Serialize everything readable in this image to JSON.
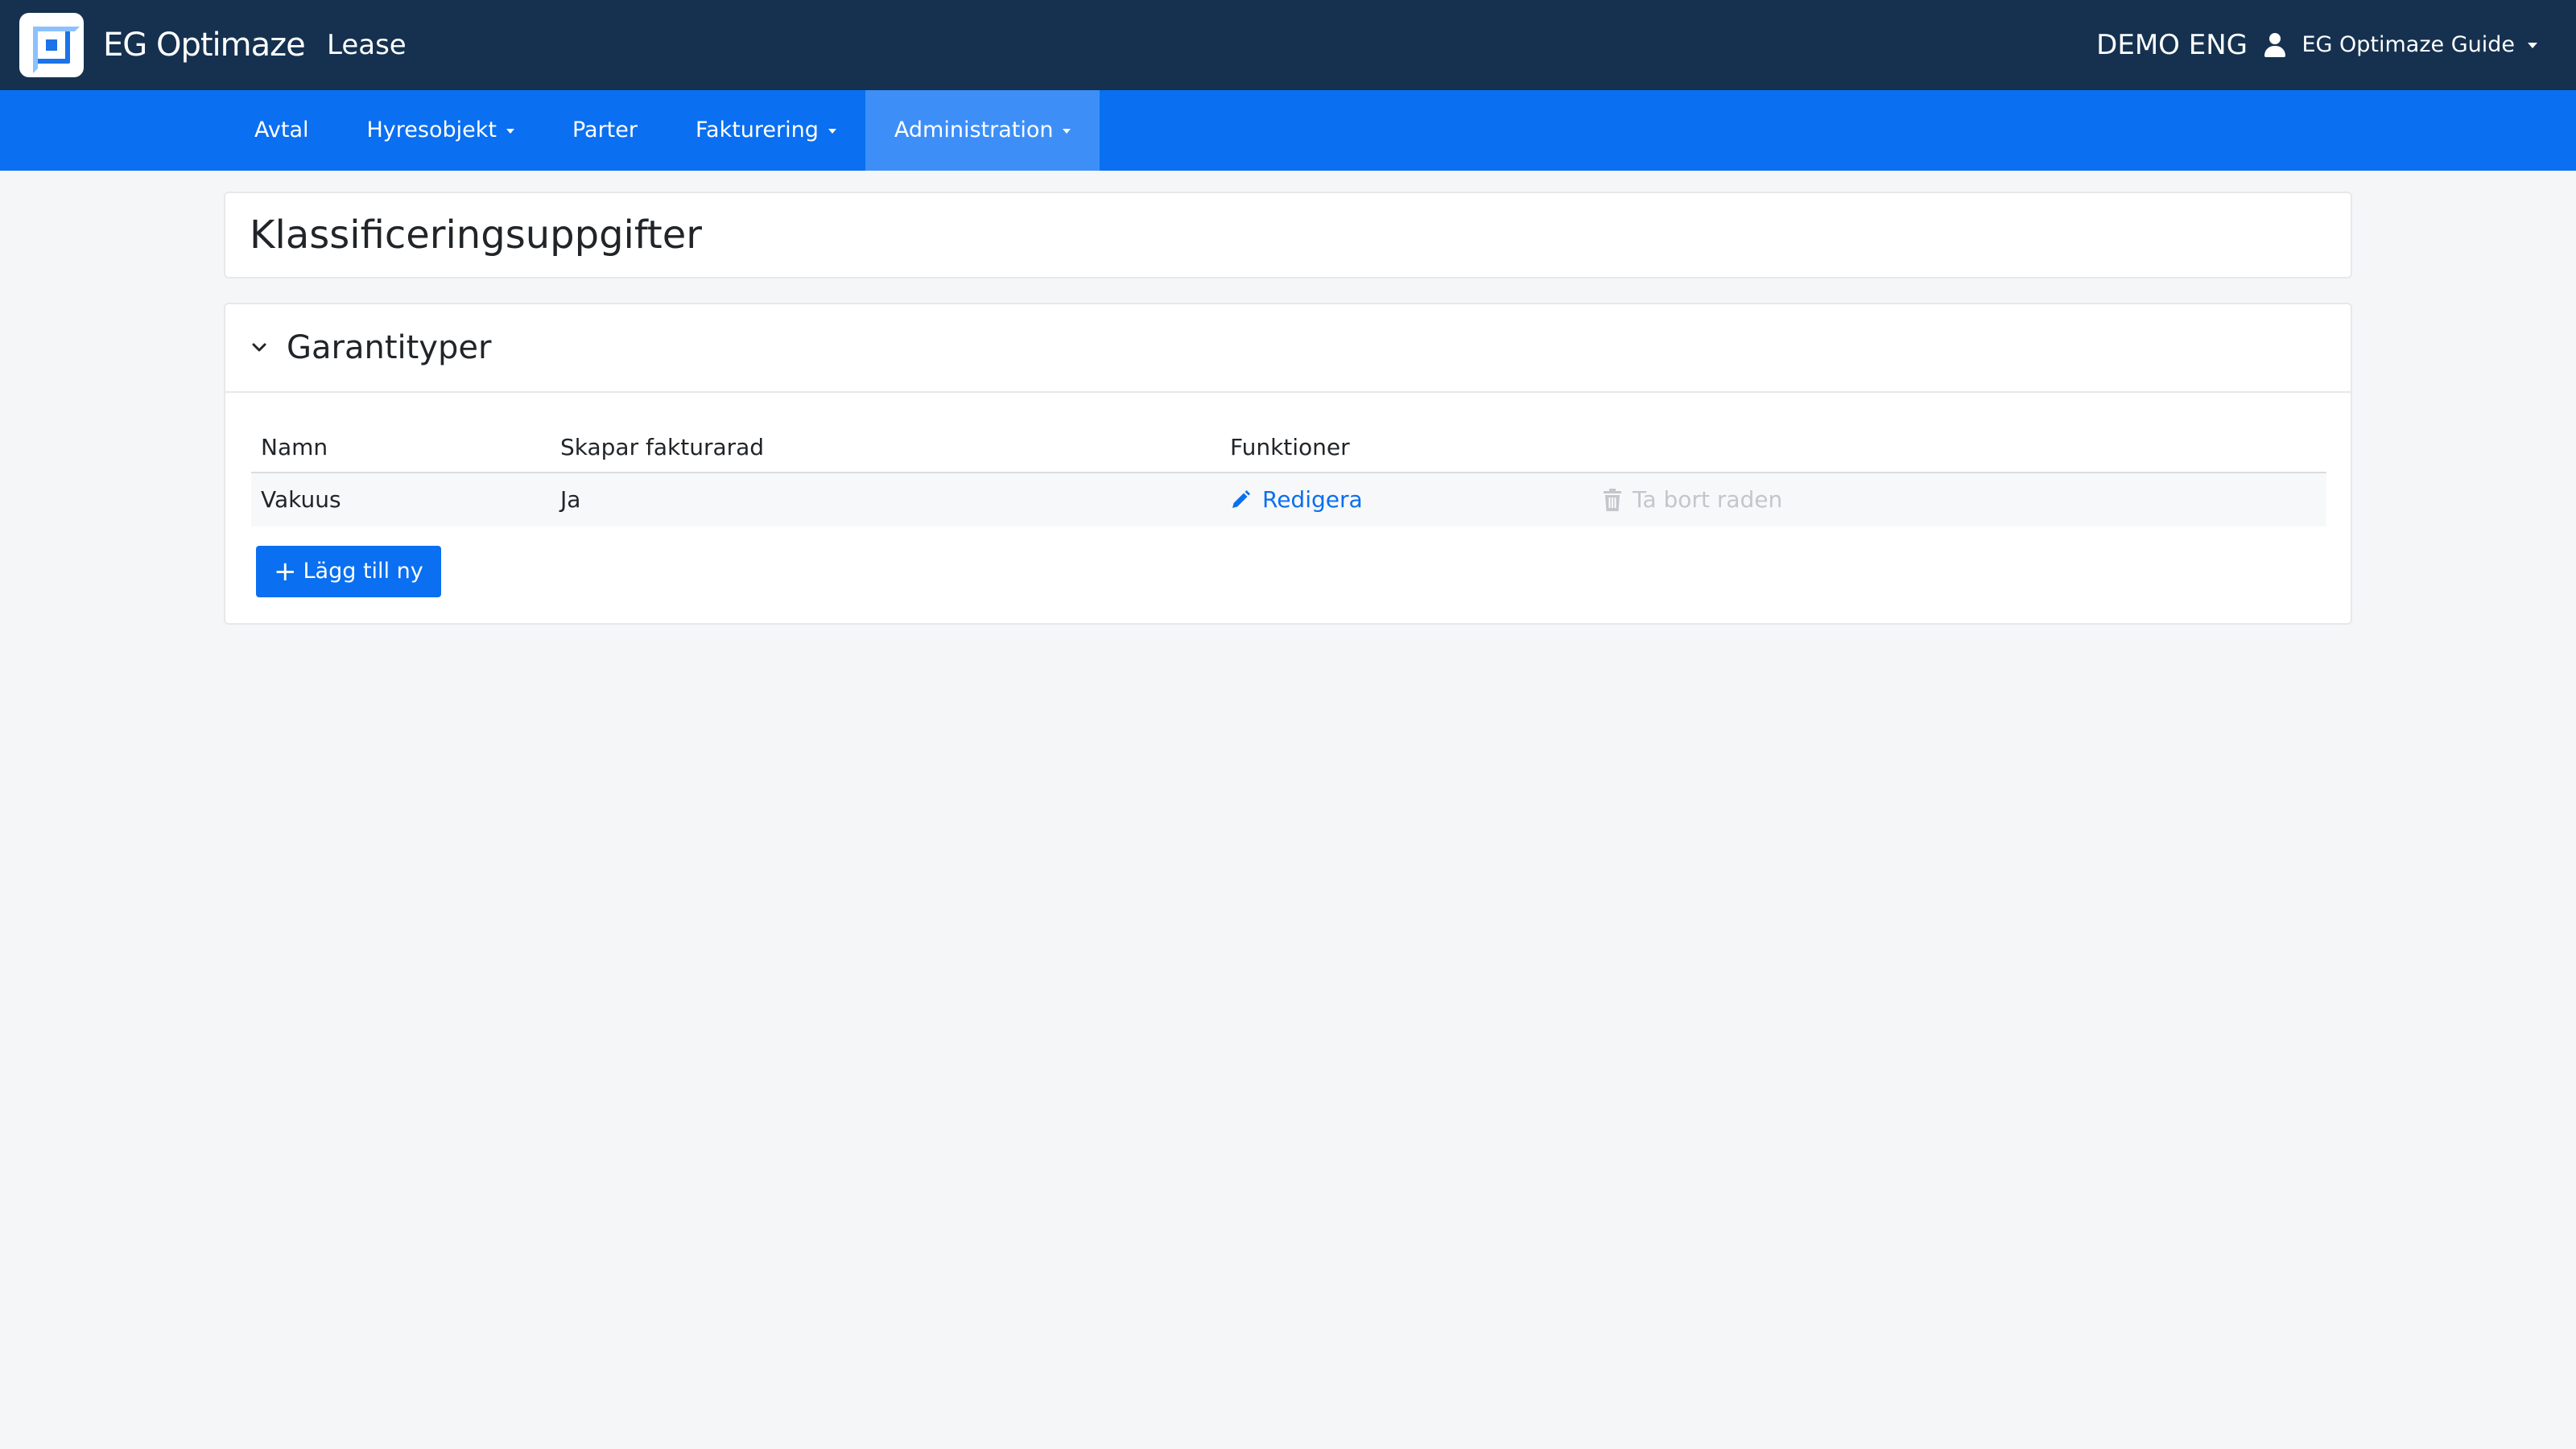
{
  "header": {
    "brand": "EG Optimaze",
    "app_name": "Lease",
    "company": "DEMO ENG",
    "user_name": "EG Optimaze Guide"
  },
  "nav": {
    "items": [
      {
        "label": "Avtal",
        "has_dropdown": false,
        "active": false
      },
      {
        "label": "Hyresobjekt",
        "has_dropdown": true,
        "active": false
      },
      {
        "label": "Parter",
        "has_dropdown": false,
        "active": false
      },
      {
        "label": "Fakturering",
        "has_dropdown": true,
        "active": false
      },
      {
        "label": "Administration",
        "has_dropdown": true,
        "active": true
      }
    ]
  },
  "page": {
    "title": "Klassificeringsuppgifter"
  },
  "section": {
    "title": "Garantityper",
    "expanded": true,
    "columns": [
      "Namn",
      "Skapar fakturarad",
      "Funktioner"
    ],
    "rows": [
      {
        "name": "Vakuus",
        "creates_invoice_row": "Ja",
        "edit_label": "Redigera",
        "delete_label": "Ta bort raden",
        "delete_disabled": true
      }
    ],
    "add_label": "Lägg till ny"
  },
  "colors": {
    "header_bg": "#15314f",
    "nav_bg": "#0a6ff0",
    "nav_active_bg": "#3d8ff7",
    "link": "#0a6ff0",
    "disabled": "#c3c6ca",
    "page_bg": "#f5f6f8"
  },
  "icons": {
    "logo": "eg-logo-icon",
    "user": "user-icon",
    "chevron": "chevron-down-icon",
    "edit": "pencil-icon",
    "delete": "trash-icon",
    "add": "plus-icon"
  }
}
